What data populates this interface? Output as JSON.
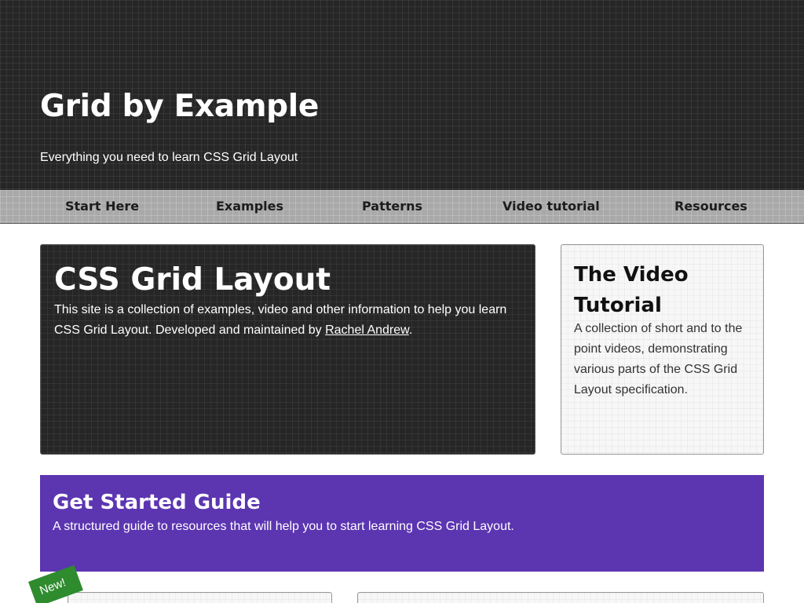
{
  "header": {
    "title": "Grid by Example",
    "tagline": "Everything you need to learn CSS Grid Layout"
  },
  "nav": {
    "items": [
      {
        "label": "Start Here"
      },
      {
        "label": "Examples"
      },
      {
        "label": "Patterns"
      },
      {
        "label": "Video tutorial"
      },
      {
        "label": "Resources"
      }
    ]
  },
  "intro": {
    "title": "CSS Grid Layout",
    "text_before_link": "This site is a collection of examples, video and other information to help you learn CSS Grid Layout. Developed and maintained by ",
    "link_label": "Rachel Andrew",
    "text_after_link": "."
  },
  "video": {
    "title": "The Video Tutorial",
    "text": "A collection of short and to the point videos, demonstrating various parts of the CSS Grid Layout specification."
  },
  "guide": {
    "title": "Get Started Guide",
    "text": "A structured guide to resources that will help you to start learning CSS Grid Layout."
  },
  "badge": {
    "label": "New!"
  },
  "colors": {
    "header_bg": "#262626",
    "nav_bg": "#a9a9a9",
    "guide_bg": "#5c35b1",
    "badge_bg": "#2e8b2e"
  }
}
